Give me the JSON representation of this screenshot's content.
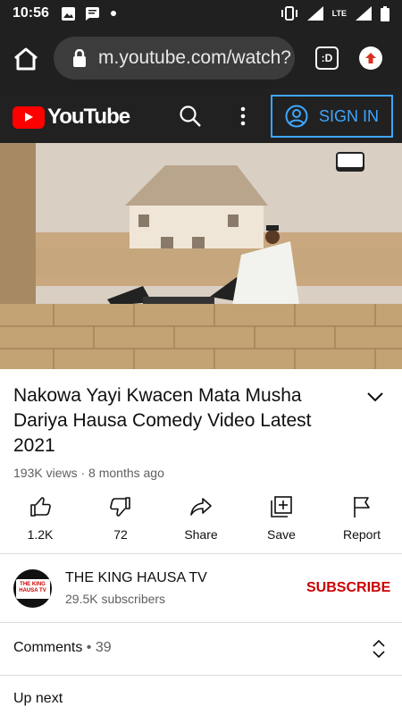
{
  "status_bar": {
    "time": "10:56",
    "icons": [
      "image-icon",
      "message-icon",
      "dot-icon",
      "vibrate-icon",
      "signal-icon",
      "lte-icon",
      "signal-icon",
      "battery-icon"
    ],
    "network": "LTE"
  },
  "browser": {
    "url": "m.youtube.com/watch?",
    "tab_label": ":D"
  },
  "youtube_header": {
    "logo_text": "YouTube",
    "sign_in_label": "SIGN IN"
  },
  "video": {
    "watermark": "THE KING HAUSA TV"
  },
  "details": {
    "title": "Nakowa Yayi Kwacen Mata Musha Dariya Hausa Comedy Video Latest 2021",
    "views": "193K views",
    "separator": " · ",
    "age": "8 months ago"
  },
  "actions": [
    {
      "icon": "thumbs-up-icon",
      "label": "1.2K"
    },
    {
      "icon": "thumbs-down-icon",
      "label": "72"
    },
    {
      "icon": "share-icon",
      "label": "Share"
    },
    {
      "icon": "save-icon",
      "label": "Save"
    },
    {
      "icon": "flag-icon",
      "label": "Report"
    }
  ],
  "channel": {
    "name": "THE KING HAUSA TV",
    "subscribers": "29.5K subscribers",
    "subscribe_label": "SUBSCRIBE",
    "avatar_text": "THE KING HAUSA TV"
  },
  "comments": {
    "label": "Comments",
    "separator": " • ",
    "count": "39"
  },
  "up_next": "Up next",
  "colors": {
    "accent_blue": "#3ea6ff",
    "youtube_red": "#ff0000",
    "subscribe_red": "#cc0000",
    "header_dark": "#212121"
  }
}
